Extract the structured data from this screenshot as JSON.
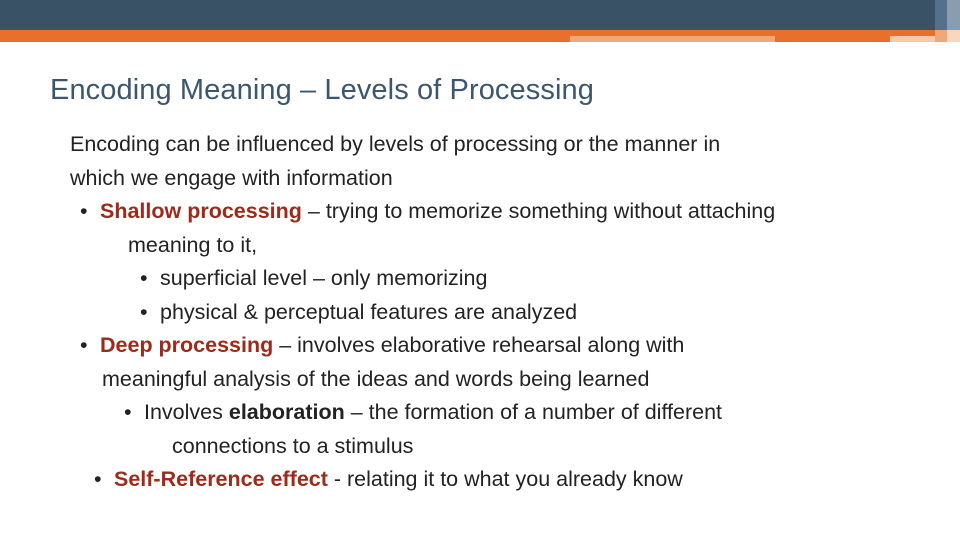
{
  "theme": {
    "header_bar_color": "#3d566e",
    "accent_bar_color": "#e8702a",
    "title_color": "#3d566e",
    "highlight_color": "#9e2a19",
    "body_color": "#222222"
  },
  "slide": {
    "title": "Encoding Meaning – Levels of Processing",
    "intro": {
      "line1": "Encoding can be influenced by levels of processing or the manner in",
      "line2": "which we engage with information"
    },
    "bullets": [
      {
        "level": 1,
        "marker": "•",
        "highlight": "Shallow processing",
        "text": " – trying to memorize something without attaching",
        "continuation": "meaning to it,"
      },
      {
        "level": 2,
        "marker": "•",
        "highlight": "",
        "text": "superficial level – only memorizing",
        "continuation": ""
      },
      {
        "level": 2,
        "marker": "•",
        "highlight": "",
        "text": "physical & perceptual features are analyzed",
        "continuation": ""
      },
      {
        "level": 1,
        "marker": "•",
        "highlight": "Deep processing",
        "text": " – involves elaborative rehearsal along with",
        "continuation": "meaningful analysis of the ideas and words being learned"
      },
      {
        "level": 2,
        "marker": "•",
        "highlight": "",
        "text": "Involves ",
        "bold": "elaboration",
        "text_after": " – the formation of a number of different",
        "continuation": "connections to a stimulus"
      },
      {
        "level": 2,
        "marker": "•",
        "highlight": "Self-Reference effect",
        "text": " - relating it to what you already know",
        "continuation": ""
      }
    ]
  }
}
